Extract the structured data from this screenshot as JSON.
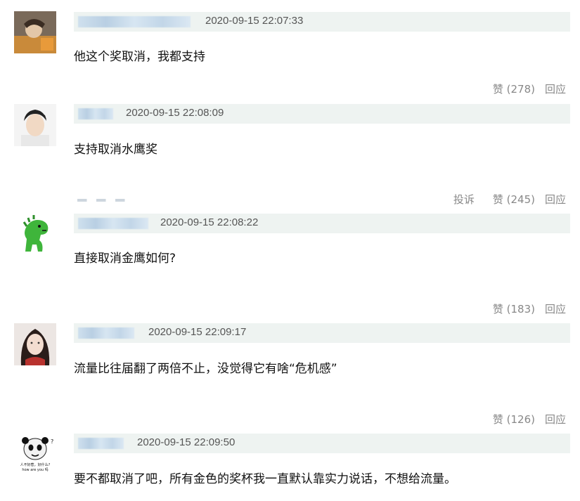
{
  "comments": [
    {
      "date": "2020-09-15 22:07:33",
      "text": "他这个奖取消，我都支持",
      "like_label": "赞 (278)",
      "reply_label": "回应",
      "report_label": ""
    },
    {
      "date": "2020-09-15 22:08:09",
      "text": "支持取消水鹰奖",
      "like_label": "赞 (245)",
      "reply_label": "回应",
      "report_label": "投诉"
    },
    {
      "date": "2020-09-15 22:08:22",
      "text": "直接取消金鹰如何?",
      "like_label": "赞 (183)",
      "reply_label": "回应",
      "report_label": ""
    },
    {
      "date": "2020-09-15 22:09:17",
      "text": "流量比往届翻了两倍不止，没觉得它有啥“危机感”",
      "like_label": "赞 (126)",
      "reply_label": "回应",
      "report_label": ""
    },
    {
      "date": "2020-09-15 22:09:50",
      "text": "要不都取消了吧，所有金色的奖杯我一直默认靠实力说话，不想给流量。",
      "like_label": "",
      "reply_label": "",
      "report_label": ""
    }
  ],
  "avatar_meme_text": {
    "line1": "人不好惹，好什么?",
    "line2": "how are you 吗"
  }
}
